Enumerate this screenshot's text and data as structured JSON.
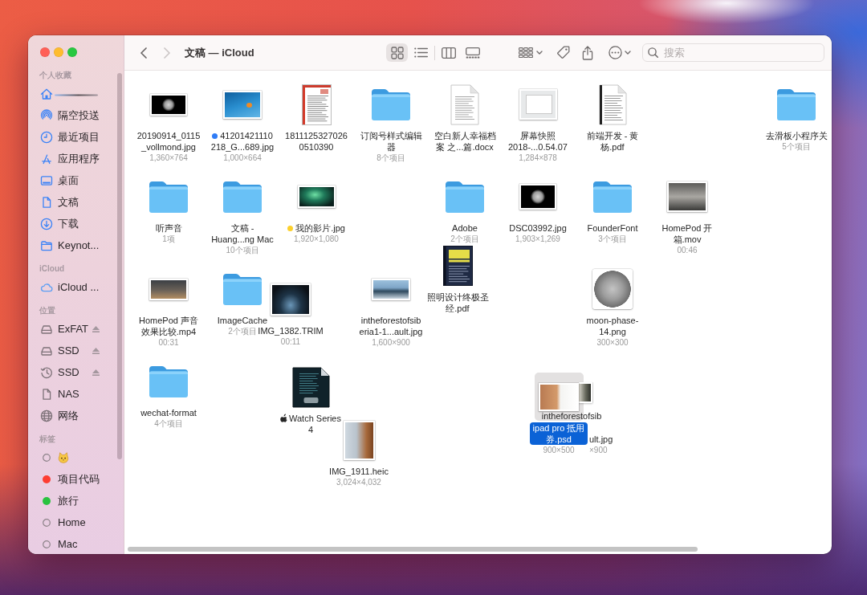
{
  "sidebar": {
    "sections": [
      {
        "title": "个人收藏",
        "items": [
          {
            "kind": "redacted"
          },
          {
            "kind": "place",
            "label": "隔空投送"
          },
          {
            "kind": "place",
            "label": "最近项目"
          },
          {
            "kind": "place",
            "label": "应用程序"
          },
          {
            "kind": "place",
            "label": "桌面"
          },
          {
            "kind": "place",
            "label": "文稿"
          },
          {
            "kind": "place",
            "label": "下载"
          },
          {
            "kind": "place",
            "label": "Keynot..."
          }
        ]
      },
      {
        "title": "iCloud",
        "items": [
          {
            "kind": "place",
            "label": "iCloud ..."
          }
        ]
      },
      {
        "title": "位置",
        "items": [
          {
            "kind": "place",
            "label": "ExFAT",
            "ejectable": true
          },
          {
            "kind": "place",
            "label": "SSD",
            "ejectable": true
          },
          {
            "kind": "place",
            "label": "SSD",
            "ejectable": true
          },
          {
            "kind": "place",
            "label": "NAS",
            "ejectable": false
          },
          {
            "kind": "place",
            "label": "网络",
            "ejectable": false
          }
        ]
      },
      {
        "title": "标签",
        "items": [
          {
            "kind": "emoji_tag"
          },
          {
            "kind": "tag",
            "label": "项目代码",
            "color": "#fd3d32"
          },
          {
            "kind": "tag",
            "label": "旅行",
            "color": "#29c23f"
          },
          {
            "kind": "tag",
            "label": "Home"
          },
          {
            "kind": "tag",
            "label": "Mac"
          }
        ]
      }
    ]
  },
  "toolbar": {
    "back": {
      "disabled": false
    },
    "forward": {
      "disabled": true
    },
    "title": "文稿 — iCloud",
    "view_modes": [
      {
        "selected": true
      },
      {
        "selected": false
      },
      {
        "selected": false
      },
      {
        "selected": false
      }
    ],
    "search": {
      "placeholder": "搜索"
    }
  },
  "files": [
    {
      "kind": "image",
      "name": "20190914_0115_vollmond.jpg",
      "detail": "1,360×764",
      "selected": false
    },
    {
      "kind": "image",
      "name": "41201421110218_G...689.jpg",
      "detail": "1,000×664",
      "color": "#2f7cf6",
      "selected": false
    },
    {
      "kind": "document",
      "name": "18111253270260510390",
      "selected": false
    },
    {
      "kind": "folder",
      "name": "订阅号样式编辑器",
      "detail": "8个项目",
      "selected": false
    },
    {
      "kind": "document",
      "name": "空白新人幸福档案 之...篇.docx",
      "selected": false
    },
    {
      "kind": "image",
      "name": "屏幕快照 2018-...0.54.07",
      "detail": "1,284×878",
      "selected": false
    },
    {
      "kind": "document",
      "name": "前端开发 - 黄杨.pdf",
      "selected": false
    },
    {
      "kind": "folder",
      "name": "去滑板小程序关",
      "detail": "5个项目",
      "selected": false
    },
    {
      "kind": "folder",
      "name": "听声音",
      "detail": "1项",
      "selected": false
    },
    {
      "kind": "folder",
      "name": "文稿 - Huang...ng Mac",
      "detail": "10个项目",
      "selected": false
    },
    {
      "kind": "image",
      "name": "我的影片.jpg",
      "detail": "1,920×1,080",
      "color": "#fcd02c",
      "selected": false
    },
    {
      "kind": "folder",
      "name": "Adobe",
      "detail": "2个项目",
      "selected": false
    },
    {
      "kind": "image",
      "name": "DSC03992.jpg",
      "detail": "1,903×1,269",
      "selected": false
    },
    {
      "kind": "folder",
      "name": "FounderFont",
      "detail": "3个项目",
      "selected": false
    },
    {
      "kind": "video",
      "name": "HomePod 开箱.mov",
      "detail": "00:46",
      "selected": false
    },
    {
      "kind": "video",
      "name": "HomePod 声音效果比较.mp4",
      "detail": "00:31",
      "selected": false
    },
    {
      "kind": "folder",
      "name": "ImageCache",
      "detail": "2个项目",
      "selected": false
    },
    {
      "kind": "video",
      "name": "IMG_1382.TRIM",
      "detail": "00:11",
      "selected": false
    },
    {
      "kind": "image",
      "name": "intheforestofsiberia1-1...ault.jpg",
      "detail": "1,600×900",
      "selected": false
    },
    {
      "kind": "document",
      "name": "照明设计终极圣经.pdf",
      "selected": false
    },
    {
      "kind": "image",
      "name": "moon-phase-14.png",
      "detail": "300×300",
      "selected": false
    },
    {
      "kind": "folder",
      "name": "wechat-format",
      "detail": "4个项目",
      "selected": false
    },
    {
      "kind": "document",
      "name": "Watch Series 4",
      "logo_prefix": true,
      "selected": false
    },
    {
      "kind": "image",
      "name": "IMG_1911.heic",
      "detail": "3,024×4,032",
      "selected": false
    },
    {
      "kind": "image",
      "name": "intheforestofsib",
      "covered_tail": {
        "name": "ult.jpg",
        "detail": "×900"
      },
      "selected": false
    },
    {
      "kind": "image",
      "name": "ipad pro 抵用券.psd",
      "detail": "900×500",
      "selected": true
    }
  ]
}
